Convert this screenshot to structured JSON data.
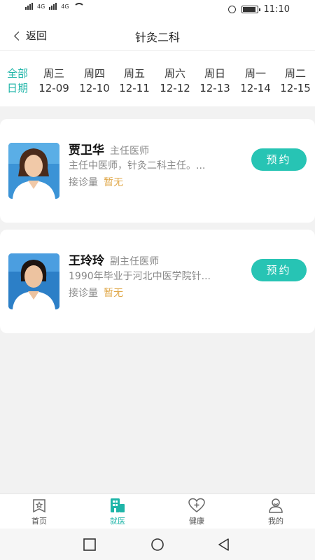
{
  "status_bar": {
    "net_left": "4G",
    "net_right": "4G",
    "time": "11:10",
    "battery_level": 0.9
  },
  "header": {
    "back_label": "返回",
    "title": "针灸二科"
  },
  "dates": [
    {
      "weekday": "全部",
      "date": "日期",
      "active": true
    },
    {
      "weekday": "周三",
      "date": "12-09"
    },
    {
      "weekday": "周四",
      "date": "12-10"
    },
    {
      "weekday": "周五",
      "date": "12-11"
    },
    {
      "weekday": "周六",
      "date": "12-12"
    },
    {
      "weekday": "周日",
      "date": "12-13"
    },
    {
      "weekday": "周一",
      "date": "12-14"
    },
    {
      "weekday": "周二",
      "date": "12-15"
    }
  ],
  "doctors": [
    {
      "name": "贾卫华",
      "title": "主任医师",
      "intro": "主任中医师，针灸二科主任。...",
      "volume_label": "接诊量",
      "volume_value": "暂无",
      "book_label": "预约"
    },
    {
      "name": "王玲玲",
      "title": "副主任医师",
      "intro": "1990年毕业于河北中医学院针...",
      "volume_label": "接诊量",
      "volume_value": "暂无",
      "book_label": "预约"
    }
  ],
  "bottom_nav": [
    {
      "label": "首页",
      "icon": "home-star-icon"
    },
    {
      "label": "就医",
      "icon": "hospital-icon",
      "active": true
    },
    {
      "label": "健康",
      "icon": "heart-plus-icon"
    },
    {
      "label": "我的",
      "icon": "user-icon"
    }
  ],
  "colors": {
    "accent": "#27c4b4",
    "active_text": "#1fb5a8",
    "highlight": "#e0a84a"
  }
}
